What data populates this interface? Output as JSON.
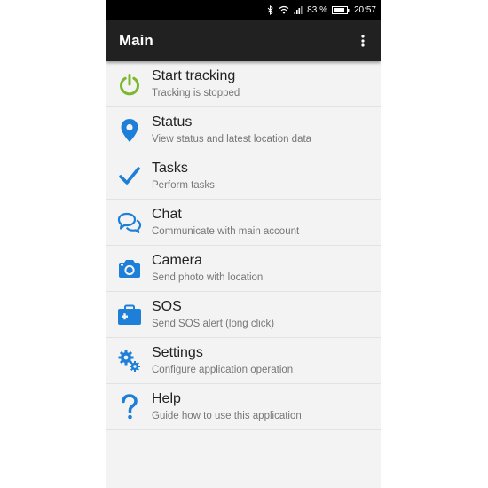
{
  "status_bar": {
    "battery_percent": "83 %",
    "time": "20:57",
    "icons": [
      "bluetooth-icon",
      "wifi-icon",
      "signal-icon",
      "battery-icon"
    ]
  },
  "app_bar": {
    "title": "Main",
    "overflow_icon": "more-vert-icon"
  },
  "colors": {
    "power_green": "#7cb82f",
    "accent_blue": "#1e7fd9",
    "app_bar": "#212121"
  },
  "menu": {
    "items": [
      {
        "title": "Start tracking",
        "subtitle": "Tracking is stopped",
        "icon": "power-icon"
      },
      {
        "title": "Status",
        "subtitle": "View status and latest location data",
        "icon": "location-pin-icon"
      },
      {
        "title": "Tasks",
        "subtitle": "Perform tasks",
        "icon": "checkmark-icon"
      },
      {
        "title": "Chat",
        "subtitle": "Communicate with main account",
        "icon": "chat-icon"
      },
      {
        "title": "Camera",
        "subtitle": "Send photo with location",
        "icon": "camera-icon"
      },
      {
        "title": "SOS",
        "subtitle": "Send SOS alert (long click)",
        "icon": "first-aid-kit-icon"
      },
      {
        "title": "Settings",
        "subtitle": "Configure application operation",
        "icon": "gears-icon"
      },
      {
        "title": "Help",
        "subtitle": "Guide how to use this application",
        "icon": "question-icon"
      }
    ]
  }
}
